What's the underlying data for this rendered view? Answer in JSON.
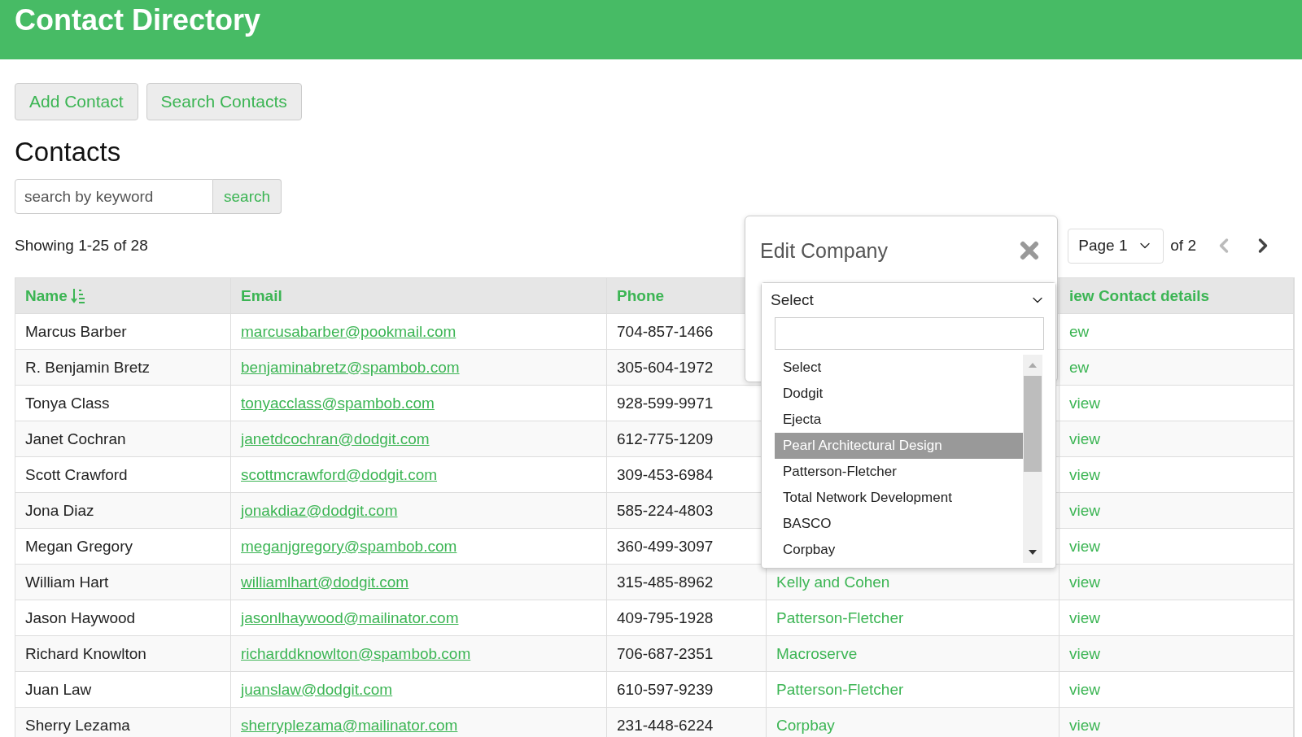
{
  "header": {
    "title": "Contact Directory"
  },
  "actions": [
    "Add Contact",
    "Search Contacts"
  ],
  "section_title": "Contacts",
  "search": {
    "placeholder": "search by keyword",
    "button": "search"
  },
  "summary": "Showing 1-25 of 28",
  "pager": {
    "page": "Page 1",
    "total": "of 2",
    "prev_disabled": true,
    "next_disabled": false
  },
  "table": {
    "columns": [
      {
        "label": "Name",
        "sorted": true
      },
      {
        "label": "Email",
        "sorted": false
      },
      {
        "label": "Phone",
        "sorted": false
      },
      {
        "label": "iew Contact details",
        "sorted": false
      }
    ],
    "rows": [
      {
        "name": "Marcus Barber",
        "email": "marcusabarber@pookmail.com",
        "phone": "704-857-1466",
        "action": "ew"
      },
      {
        "name": "R. Benjamin Bretz",
        "email": "benjaminabretz@spambob.com",
        "phone": "305-604-1972",
        "action": "ew"
      },
      {
        "name": "Tonya Class",
        "email": "tonyacclass@spambob.com",
        "phone": "928-599-9971",
        "action": "view"
      },
      {
        "name": "Janet Cochran",
        "email": "janetdcochran@dodgit.com",
        "phone": "612-775-1209",
        "action": "view"
      },
      {
        "name": "Scott Crawford",
        "email": "scottmcrawford@dodgit.com",
        "phone": "309-453-6984",
        "action": "view"
      },
      {
        "name": "Jona Diaz",
        "email": "jonakdiaz@dodgit.com",
        "phone": "585-224-4803",
        "action": "view"
      },
      {
        "name": "Megan Gregory",
        "email": "meganjgregory@spambob.com",
        "phone": "360-499-3097",
        "action": "view"
      },
      {
        "name": "William Hart",
        "email": "williamlhart@dodgit.com",
        "phone": "315-485-8962",
        "company": "Kelly and Cohen",
        "action": "view"
      },
      {
        "name": "Jason Haywood",
        "email": "jasonlhaywood@mailinator.com",
        "phone": "409-795-1928",
        "company": "Patterson-Fletcher",
        "action": "view"
      },
      {
        "name": "Richard Knowlton",
        "email": "richarddknowlton@spambob.com",
        "phone": "706-687-2351",
        "company": "Macroserve",
        "action": "view"
      },
      {
        "name": "Juan Law",
        "email": "juanslaw@dodgit.com",
        "phone": "610-597-9239",
        "company": "Patterson-Fletcher",
        "action": "view"
      },
      {
        "name": "Sherry Lezama",
        "email": "sherryplezama@mailinator.com",
        "phone": "231-448-6224",
        "company": "Corpbay",
        "action": "view"
      }
    ]
  },
  "dialog": {
    "title": "Edit Company",
    "select": {
      "value": "Select",
      "options": [
        {
          "label": "Select",
          "highlighted": false
        },
        {
          "label": "Dodgit",
          "highlighted": false
        },
        {
          "label": "Ejecta",
          "highlighted": false
        },
        {
          "label": "Pearl Architectural Design",
          "highlighted": true
        },
        {
          "label": "Patterson-Fletcher",
          "highlighted": false
        },
        {
          "label": "Total Network Development",
          "highlighted": false
        },
        {
          "label": "BASCO",
          "highlighted": false
        },
        {
          "label": "Corpbay",
          "highlighted": false
        }
      ]
    }
  }
}
